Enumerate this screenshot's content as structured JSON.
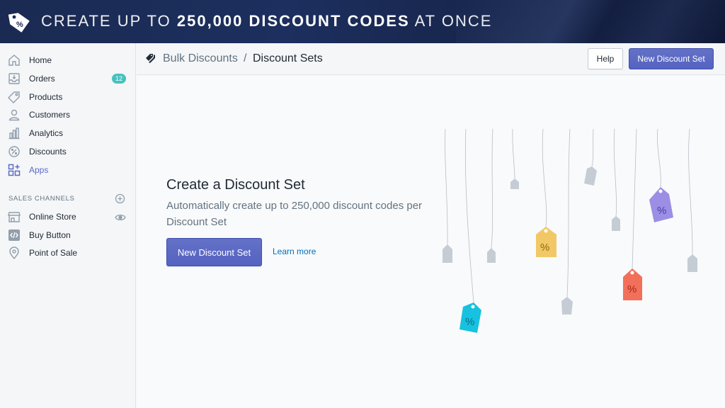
{
  "banner": {
    "title_light_1": "CREATE UP TO ",
    "title_bold": "250,000 DISCOUNT CODES",
    "title_light_2": " AT ONCE",
    "logo_icon": "percent-tag-icon"
  },
  "sidebar": {
    "items": [
      {
        "label": "Home",
        "icon": "home-icon"
      },
      {
        "label": "Orders",
        "icon": "orders-icon",
        "badge": "12"
      },
      {
        "label": "Products",
        "icon": "tag-icon"
      },
      {
        "label": "Customers",
        "icon": "person-icon"
      },
      {
        "label": "Analytics",
        "icon": "bar-chart-icon"
      },
      {
        "label": "Discounts",
        "icon": "discount-icon"
      },
      {
        "label": "Apps",
        "icon": "apps-icon",
        "active": true
      }
    ],
    "channels_title": "SALES CHANNELS",
    "channels": [
      {
        "label": "Online Store",
        "icon": "store-icon",
        "trailing_icon": "eye-icon"
      },
      {
        "label": "Buy Button",
        "icon": "code-icon"
      },
      {
        "label": "Point of Sale",
        "icon": "location-pin-icon"
      }
    ]
  },
  "topbar": {
    "breadcrumb_app": "Bulk Discounts",
    "breadcrumb_sep": "/",
    "breadcrumb_current": "Discount Sets",
    "help_label": "Help",
    "new_label": "New Discount Set"
  },
  "main": {
    "title": "Create a Discount Set",
    "description": "Automatically create up to 250,000 discount codes per Discount Set",
    "button_label": "New Discount Set",
    "learn_more": "Learn more"
  },
  "colors": {
    "accent": "#5c6ac4",
    "badge": "#47c1bf",
    "link": "#006fbb",
    "tag_purple": "#9c8ee4",
    "tag_yellow": "#f1c865",
    "tag_red": "#f2705a",
    "tag_blue": "#17c1e0",
    "tag_gray": "#c5ccd4"
  }
}
